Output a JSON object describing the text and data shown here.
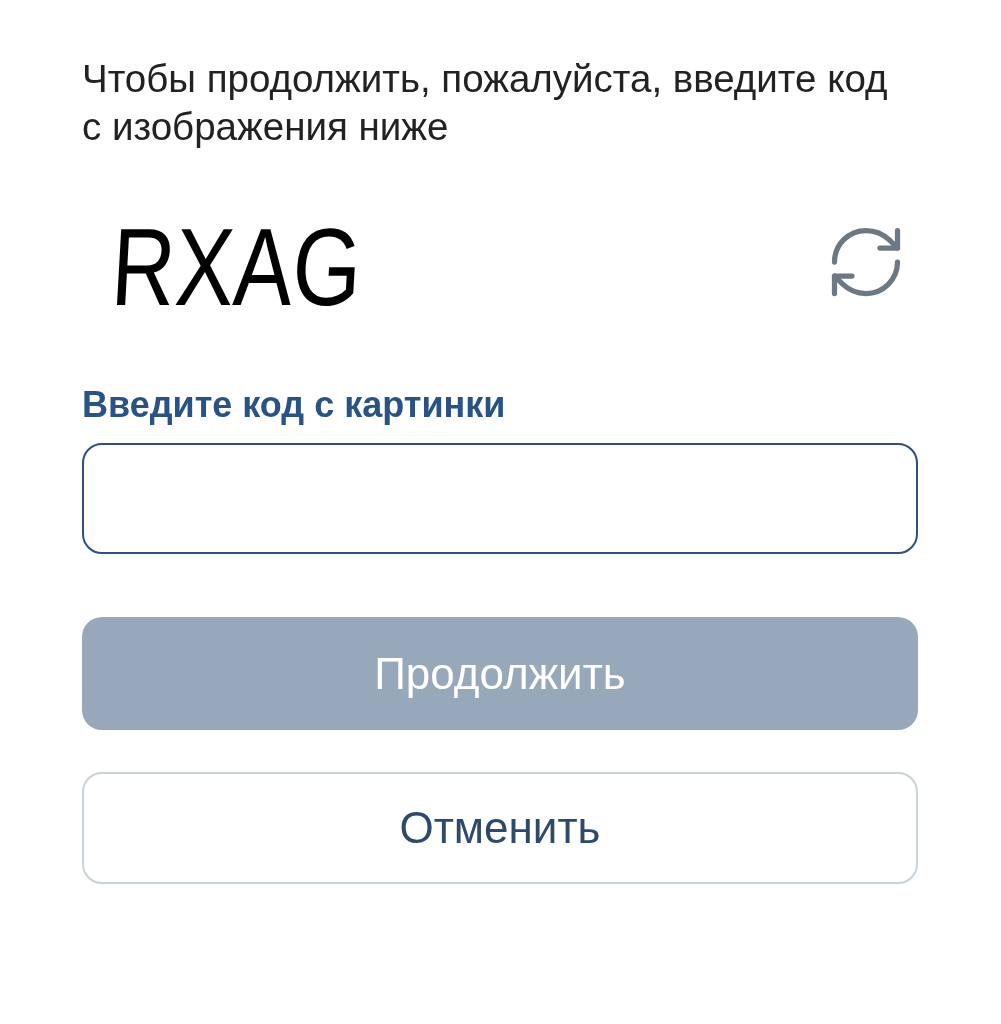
{
  "instructions": "Чтобы продолжить, пожалуйста, введите код с изображения ниже",
  "captcha": {
    "code": "RXAG"
  },
  "field": {
    "label": "Введите код с картинки",
    "focused": true
  },
  "buttons": [
    {
      "kind": "primary",
      "label": "Продолжить",
      "disabled": true
    },
    {
      "kind": "secondary",
      "label": "Отменить",
      "disabled": false
    }
  ]
}
